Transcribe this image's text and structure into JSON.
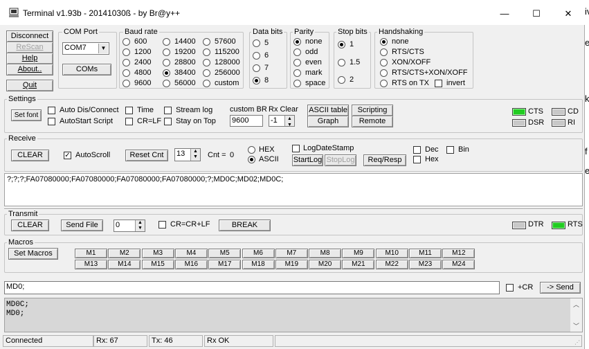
{
  "window": {
    "title": "Terminal v1.93b - 20141030ß - by Br@y++",
    "minimize": "—",
    "maximize": "☐",
    "close": "✕"
  },
  "left_buttons": {
    "disconnect": "Disconnect",
    "rescan": "ReScan",
    "help": "Help",
    "about": "About..",
    "quit": "Quit"
  },
  "com_port": {
    "title": "COM Port",
    "selected": "COM7",
    "coms_button": "COMs"
  },
  "baud_rate": {
    "title": "Baud rate",
    "options": [
      "600",
      "1200",
      "2400",
      "4800",
      "9600",
      "14400",
      "19200",
      "28800",
      "38400",
      "56000",
      "57600",
      "115200",
      "128000",
      "256000",
      "custom"
    ],
    "selected": "38400"
  },
  "data_bits": {
    "title": "Data bits",
    "options": [
      "5",
      "6",
      "7",
      "8"
    ],
    "selected": "8"
  },
  "parity": {
    "title": "Parity",
    "options": [
      "none",
      "odd",
      "even",
      "mark",
      "space"
    ],
    "selected": "none"
  },
  "stop_bits": {
    "title": "Stop bits",
    "options": [
      "1",
      "1.5",
      "2"
    ],
    "selected": "1"
  },
  "handshaking": {
    "title": "Handshaking",
    "options": [
      "none",
      "RTS/CTS",
      "XON/XOFF",
      "RTS/CTS+XON/XOFF",
      "RTS on TX"
    ],
    "selected": "none",
    "invert": "invert"
  },
  "settings": {
    "title": "Settings",
    "set_font": "Set font",
    "auto_dis_connect": "Auto Dis/Connect",
    "autostart_script": "AutoStart Script",
    "time": "Time",
    "cr_lf": "CR=LF",
    "stream_log": "Stream log",
    "stay_on_top": "Stay on Top",
    "custom_br_label": "custom BR",
    "custom_br_value": "9600",
    "rx_clear_label": "Rx Clear",
    "rx_clear_value": "-1",
    "ascii_table": "ASCII table",
    "scripting": "Scripting",
    "graph": "Graph",
    "remote": "Remote",
    "cts": "CTS",
    "cd": "CD",
    "dsr": "DSR",
    "ri": "RI"
  },
  "receive": {
    "title": "Receive",
    "clear": "CLEAR",
    "autoscroll": "AutoScroll",
    "autoscroll_checked": true,
    "reset_cnt": "Reset Cnt",
    "cnt_spin": "13",
    "cnt_label": "Cnt = ",
    "cnt_value": "0",
    "hex": "HEX",
    "ascii": "ASCII",
    "selected_mode": "ASCII",
    "log_datestamp": "LogDateStamp",
    "start_log": "StartLog",
    "stop_log": "StopLog",
    "req_resp": "Req/Resp",
    "dec": "Dec",
    "hex_chk": "Hex",
    "bin": "Bin",
    "content": "?;?;?;FA07080000;FA07080000;FA07080000;FA07080000;?;MD0C;MD02;MD0C;"
  },
  "transmit": {
    "title": "Transmit",
    "clear": "CLEAR",
    "send_file": "Send File",
    "spin_value": "0",
    "cr_crlf": "CR=CR+LF",
    "break": "BREAK",
    "dtr": "DTR",
    "rts": "RTS"
  },
  "macros": {
    "title": "Macros",
    "set_macros": "Set Macros",
    "row1": [
      "M1",
      "M2",
      "M3",
      "M4",
      "M5",
      "M6",
      "M7",
      "M8",
      "M9",
      "M10",
      "M11",
      "M12"
    ],
    "row2": [
      "M13",
      "M14",
      "M15",
      "M16",
      "M17",
      "M18",
      "M19",
      "M20",
      "M21",
      "M22",
      "M23",
      "M24"
    ]
  },
  "send": {
    "input_value": "MD0;",
    "plus_cr": "+CR",
    "send_button": "-> Send"
  },
  "transmit_log": {
    "lines": [
      "MD0C;",
      "MD0;"
    ]
  },
  "status": {
    "connected": "Connected",
    "rx": "Rx: 67",
    "tx": "Tx: 46",
    "rx_ok": "Rx OK"
  },
  "behind_window_chars": [
    "iv",
    "e",
    "k",
    "f",
    "e"
  ],
  "colors": {
    "led_green": "#22cc22",
    "led_gray": "#c8c8c8",
    "window_bg": "#f0f0f0"
  }
}
